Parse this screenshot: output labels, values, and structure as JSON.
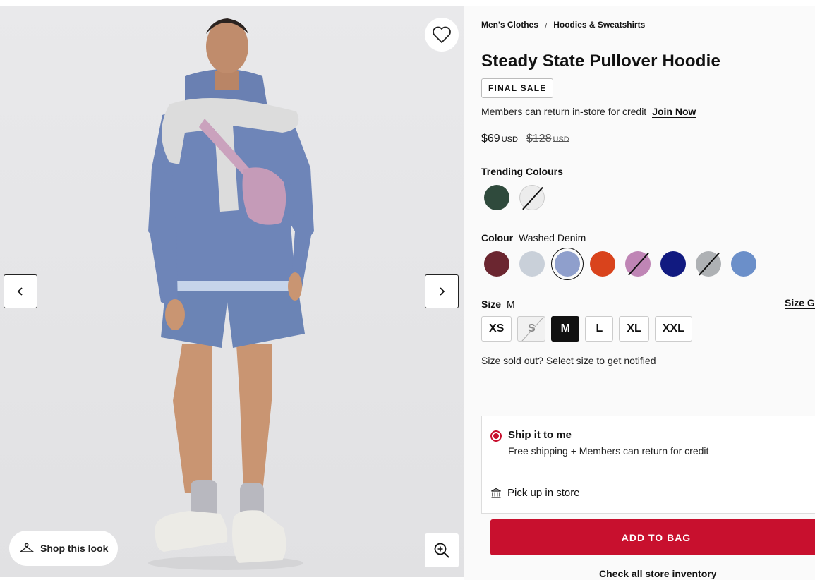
{
  "gallery": {
    "shop_look_label": "Shop this look",
    "icons": {
      "favorite": "heart-outline-icon",
      "prev": "chevron-left-icon",
      "next": "chevron-right-icon",
      "shop_look": "hanger-icon",
      "zoom": "zoom-in-icon"
    }
  },
  "breadcrumb": {
    "items": [
      "Men's Clothes",
      "Hoodies & Sweatshirts"
    ],
    "separator": "/"
  },
  "product": {
    "title": "Steady State Pullover Hoodie",
    "badge": "FINAL SALE",
    "members_text": "Members can return in-store for credit",
    "join_label": "Join Now",
    "price": "$69",
    "price_currency": "USD",
    "was_price": "$128",
    "was_currency": "USD"
  },
  "trending": {
    "label": "Trending Colours",
    "swatches": [
      {
        "name": "dark green",
        "color": "#2f4a3c",
        "available": true
      },
      {
        "name": "white",
        "color": "#ececec",
        "available": false
      }
    ]
  },
  "colour": {
    "label": "Colour",
    "selected_value": "Washed Denim",
    "swatches": [
      {
        "name": "burgundy",
        "color": "#6b2630",
        "available": true
      },
      {
        "name": "light grey blue",
        "color": "#c9d0d9",
        "available": true
      },
      {
        "name": "washed denim",
        "color": "#8f9fcc",
        "available": true,
        "selected": true
      },
      {
        "name": "orange",
        "color": "#d9431c",
        "available": true
      },
      {
        "name": "pink",
        "color": "#bf85b5",
        "available": false
      },
      {
        "name": "navy",
        "color": "#111a80",
        "available": true
      },
      {
        "name": "grey",
        "color": "#aeb1b4",
        "available": false
      },
      {
        "name": "denim blue",
        "color": "#6b8fc9",
        "available": true
      }
    ]
  },
  "size": {
    "label": "Size",
    "selected_value": "M",
    "guide_label": "Size G",
    "options": [
      {
        "label": "XS",
        "state": "available"
      },
      {
        "label": "S",
        "state": "sold"
      },
      {
        "label": "M",
        "state": "selected"
      },
      {
        "label": "L",
        "state": "available"
      },
      {
        "label": "XL",
        "state": "available"
      },
      {
        "label": "XXL",
        "state": "available"
      }
    ],
    "sold_out_note": "Size sold out? Select size to get notified"
  },
  "fulfilment": {
    "ship_title": "Ship it to me",
    "ship_sub": "Free shipping + Members can return for credit",
    "pickup_label": "Pick up in store",
    "icons": {
      "pickup": "store-icon"
    }
  },
  "actions": {
    "add_to_bag": "ADD TO BAG",
    "check_inventory": "Check all store inventory"
  },
  "colors": {
    "accent": "#c8102e"
  }
}
